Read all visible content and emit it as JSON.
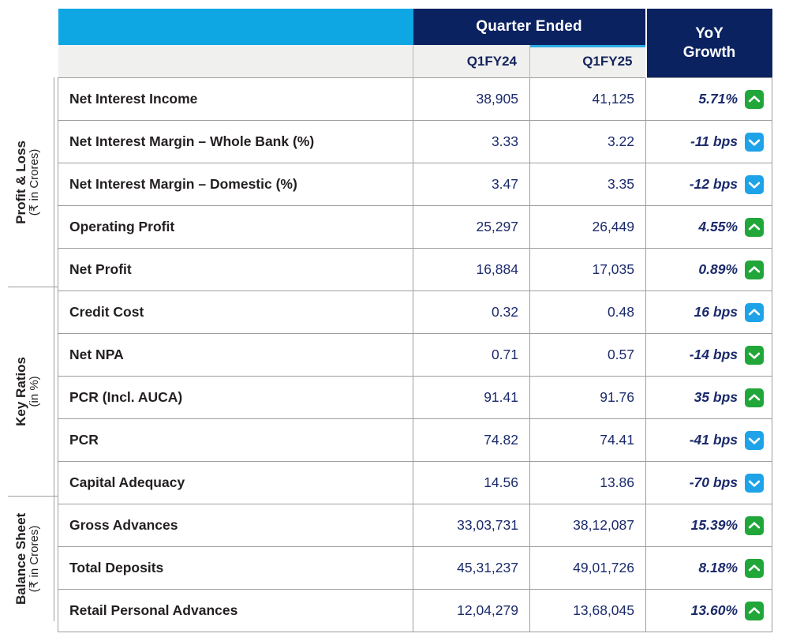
{
  "header": {
    "spacer_label": "",
    "quarter_ended": "Quarter Ended",
    "yoy_growth": "YoY\nGrowth",
    "yoy_growth_line1": "YoY",
    "yoy_growth_line2": "Growth",
    "col_q1": "Q1FY24",
    "col_q2": "Q1FY25"
  },
  "colors": {
    "cyan": "#0FA6E4",
    "navy": "#0B2261",
    "subheader_grey": "#F0F0EE",
    "value_navy": "#1B2A6B",
    "badge_green": "#21A63A",
    "badge_blue": "#1FA3E8",
    "grid": "#9E9E9E"
  },
  "sections": [
    {
      "title": "Profit & Loss",
      "subtitle": "(₹ in Crores)",
      "rows": [
        {
          "label": "Net Interest Income",
          "q1fy24": "38,905",
          "q1fy25": "41,125",
          "yoy": "5.71%",
          "arrow": "chevron-up-icon",
          "arrow_color": "#21A63A"
        },
        {
          "label": "Net Interest Margin – Whole Bank (%)",
          "q1fy24": "3.33",
          "q1fy25": "3.22",
          "yoy": "-11 bps",
          "arrow": "chevron-down-icon",
          "arrow_color": "#1FA3E8"
        },
        {
          "label": "Net Interest Margin – Domestic (%)",
          "q1fy24": "3.47",
          "q1fy25": "3.35",
          "yoy": "-12 bps",
          "arrow": "chevron-down-icon",
          "arrow_color": "#1FA3E8"
        },
        {
          "label": "Operating Profit",
          "q1fy24": "25,297",
          "q1fy25": "26,449",
          "yoy": "4.55%",
          "arrow": "chevron-up-icon",
          "arrow_color": "#21A63A"
        },
        {
          "label": "Net Profit",
          "q1fy24": "16,884",
          "q1fy25": "17,035",
          "yoy": "0.89%",
          "arrow": "chevron-up-icon",
          "arrow_color": "#21A63A"
        }
      ]
    },
    {
      "title": "Key Ratios",
      "subtitle": "(in %)",
      "rows": [
        {
          "label": "Credit Cost",
          "q1fy24": "0.32",
          "q1fy25": "0.48",
          "yoy": "16 bps",
          "arrow": "chevron-up-icon",
          "arrow_color": "#1FA3E8"
        },
        {
          "label": "Net NPA",
          "q1fy24": "0.71",
          "q1fy25": "0.57",
          "yoy": "-14 bps",
          "arrow": "chevron-down-icon",
          "arrow_color": "#21A63A"
        },
        {
          "label": "PCR (Incl. AUCA)",
          "q1fy24": "91.41",
          "q1fy25": "91.76",
          "yoy": "35 bps",
          "arrow": "chevron-up-icon",
          "arrow_color": "#21A63A"
        },
        {
          "label": "PCR",
          "q1fy24": "74.82",
          "q1fy25": "74.41",
          "yoy": "-41 bps",
          "arrow": "chevron-down-icon",
          "arrow_color": "#1FA3E8"
        },
        {
          "label": "Capital Adequacy",
          "q1fy24": "14.56",
          "q1fy25": "13.86",
          "yoy": "-70 bps",
          "arrow": "chevron-down-icon",
          "arrow_color": "#1FA3E8"
        }
      ]
    },
    {
      "title": "Balance Sheet",
      "subtitle": "(₹ in Crores)",
      "rows": [
        {
          "label": "Gross Advances",
          "q1fy24": "33,03,731",
          "q1fy25": "38,12,087",
          "yoy": "15.39%",
          "arrow": "chevron-up-icon",
          "arrow_color": "#21A63A"
        },
        {
          "label": "Total Deposits",
          "q1fy24": "45,31,237",
          "q1fy25": "49,01,726",
          "yoy": "8.18%",
          "arrow": "chevron-up-icon",
          "arrow_color": "#21A63A"
        },
        {
          "label": "Retail Personal Advances",
          "q1fy24": "12,04,279",
          "q1fy25": "13,68,045",
          "yoy": "13.60%",
          "arrow": "chevron-up-icon",
          "arrow_color": "#21A63A"
        }
      ]
    }
  ]
}
